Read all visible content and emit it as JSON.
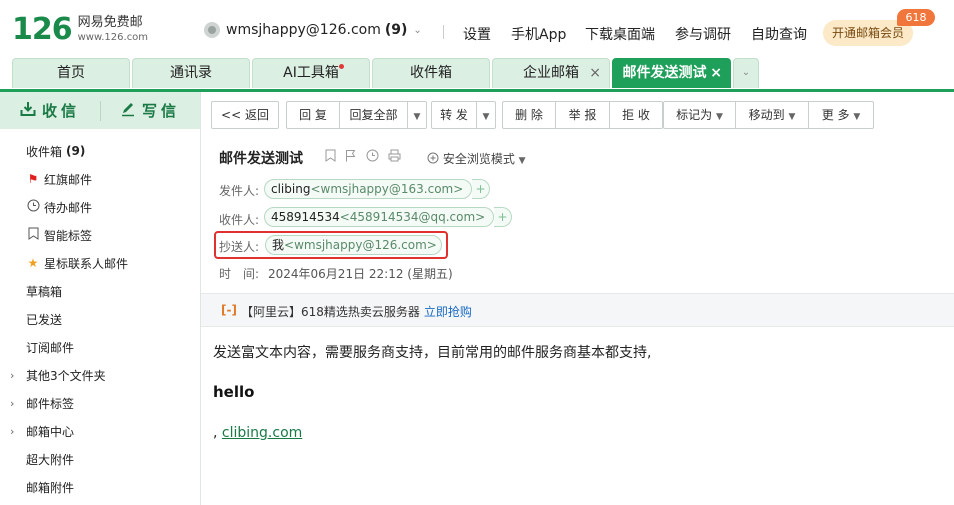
{
  "header": {
    "logo_num": "126",
    "logo_cn": "网易免费邮",
    "logo_url": "www.126.com",
    "account_email": "wmsjhappy@126.com",
    "account_unread": "(9)",
    "nav": [
      "设置",
      "手机App",
      "下载桌面端",
      "参与调研",
      "自助查询"
    ],
    "vip_label": "开通邮箱会员",
    "vip_badge": "618"
  },
  "tabs": [
    {
      "label": "首页"
    },
    {
      "label": "通讯录"
    },
    {
      "label": "AI工具箱"
    },
    {
      "label": "收件箱"
    },
    {
      "label": "企业邮箱"
    },
    {
      "label": "邮件发送测试"
    }
  ],
  "sidebar": {
    "receive_label": "收信",
    "write_label": "写信",
    "inbox_label": "收件箱",
    "inbox_count": "(9)",
    "folders": [
      "红旗邮件",
      "待办邮件",
      "智能标签",
      "星标联系人邮件",
      "草稿箱",
      "已发送",
      "订阅邮件",
      "其他3个文件夹",
      "邮件标签",
      "邮箱中心",
      "超大附件",
      "邮箱附件"
    ]
  },
  "toolbar": {
    "back": "<< 返回",
    "reply": "回 复",
    "reply_all": "回复全部",
    "forward": "转 发",
    "delete": "删 除",
    "report": "举 报",
    "reject": "拒 收",
    "mark_as": "标记为",
    "move_to": "移动到",
    "more": "更 多"
  },
  "mail": {
    "subject": "邮件发送测试",
    "safe_mode": "安全浏览模式",
    "from_label": "发件人:",
    "from_name": "clibing",
    "from_addr": "<wmsjhappy@163.com>",
    "to_label": "收件人:",
    "to_name": "458914534",
    "to_addr": "<458914534@qq.com>",
    "cc_label": "抄送人:",
    "cc_name": "我",
    "cc_addr": "<wmsjhappy@126.com>",
    "time_label": "时　间:",
    "time_value": "2024年06月21日 22:12 (星期五)"
  },
  "ad": {
    "text": "【阿里云】618精选热卖云服务器",
    "link": "立即抢购"
  },
  "body": {
    "line1": "发送富文本内容，需要服务商支持，目前常用的邮件服务商基本都支持,",
    "hello": "hello",
    "prefix": ", ",
    "link": "clibing.com"
  },
  "colors": {
    "brand_green": "#1ea05a",
    "tab_bg": "#dcefe3",
    "highlight_red": "#e03030",
    "vip_badge": "#f0763c"
  }
}
